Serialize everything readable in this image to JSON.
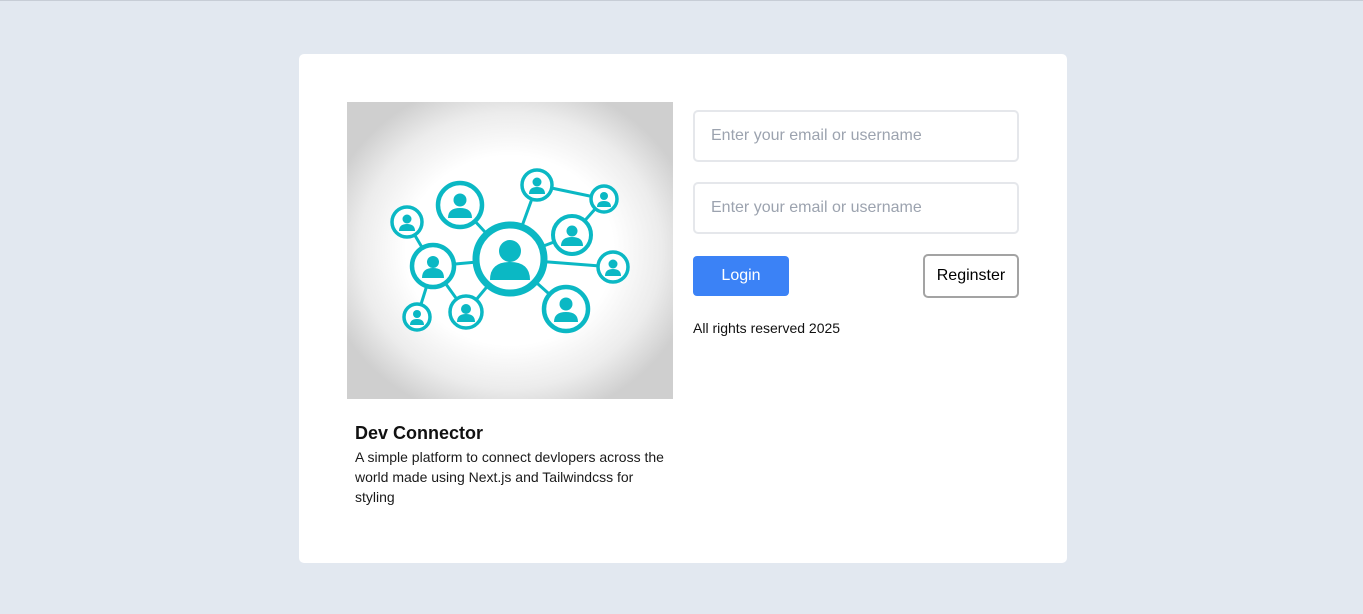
{
  "brand": {
    "title": "Dev Connector",
    "description": "A simple platform to connect devlopers across the world made using Next.js and Tailwindcss for styling",
    "illustration_icon": "network-people-icon",
    "accent_color": "#0bb8c4"
  },
  "form": {
    "first_placeholder": "Enter your email or username",
    "second_placeholder": "Enter your email or username",
    "login_label": "Login",
    "register_label": "Reginster",
    "login_color": "#3b82f6"
  },
  "footer": {
    "rights": "All rights reserved 2025"
  }
}
